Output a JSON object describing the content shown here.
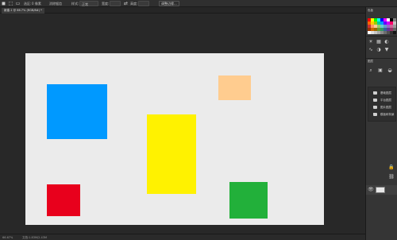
{
  "options_bar": {
    "label_1": "选区:",
    "value_1": "0 像素",
    "label_2": "消除锯齿",
    "label_3": "样式:",
    "value_3": "正常",
    "label_4": "宽度:",
    "label_5": "高度:",
    "refine_button": "调整边缘..."
  },
  "document_tab": {
    "title": "新建-1 @ 66.7% (RGB/8#) *"
  },
  "status_bar": {
    "zoom": "66.67%",
    "doc_info": "文档:1.83M/2.43M"
  },
  "right_panel": {
    "swatches_title": "色板",
    "swatch_colors": [
      "#ff0000",
      "#ffff00",
      "#00ff00",
      "#00ffff",
      "#0000ff",
      "#ff00ff",
      "#ffffff",
      "#000000",
      "#808080",
      "#ff6600",
      "#ffcc00",
      "#99cc00",
      "#00cc99",
      "#0099ff",
      "#6600ff",
      "#cc00ff",
      "#ff0066",
      "#c0c0c0",
      "#cc3333",
      "#ff9966",
      "#ffcc99",
      "#99cc66",
      "#66cccc",
      "#6699cc",
      "#9966cc",
      "#cc6699",
      "#999999",
      "#993300",
      "#cc6600",
      "#996600",
      "#669933",
      "#339966",
      "#336699",
      "#663399",
      "#993366",
      "#666666",
      "#ffffff",
      "#e0e0e0",
      "#c8c8c8",
      "#aaaaaa",
      "#8c8c8c",
      "#6e6e6e",
      "#505050",
      "#323232",
      "#141414"
    ],
    "layers_title": "图层",
    "layer_groups": [
      "基础图层",
      "平台图层",
      "图片图层",
      "模板和背景"
    ]
  },
  "canvas_shapes": {
    "blue": "#0099ff",
    "peach": "#ffcc8f",
    "yellow": "#fff200",
    "red": "#e8001c",
    "green": "#22b03a"
  }
}
